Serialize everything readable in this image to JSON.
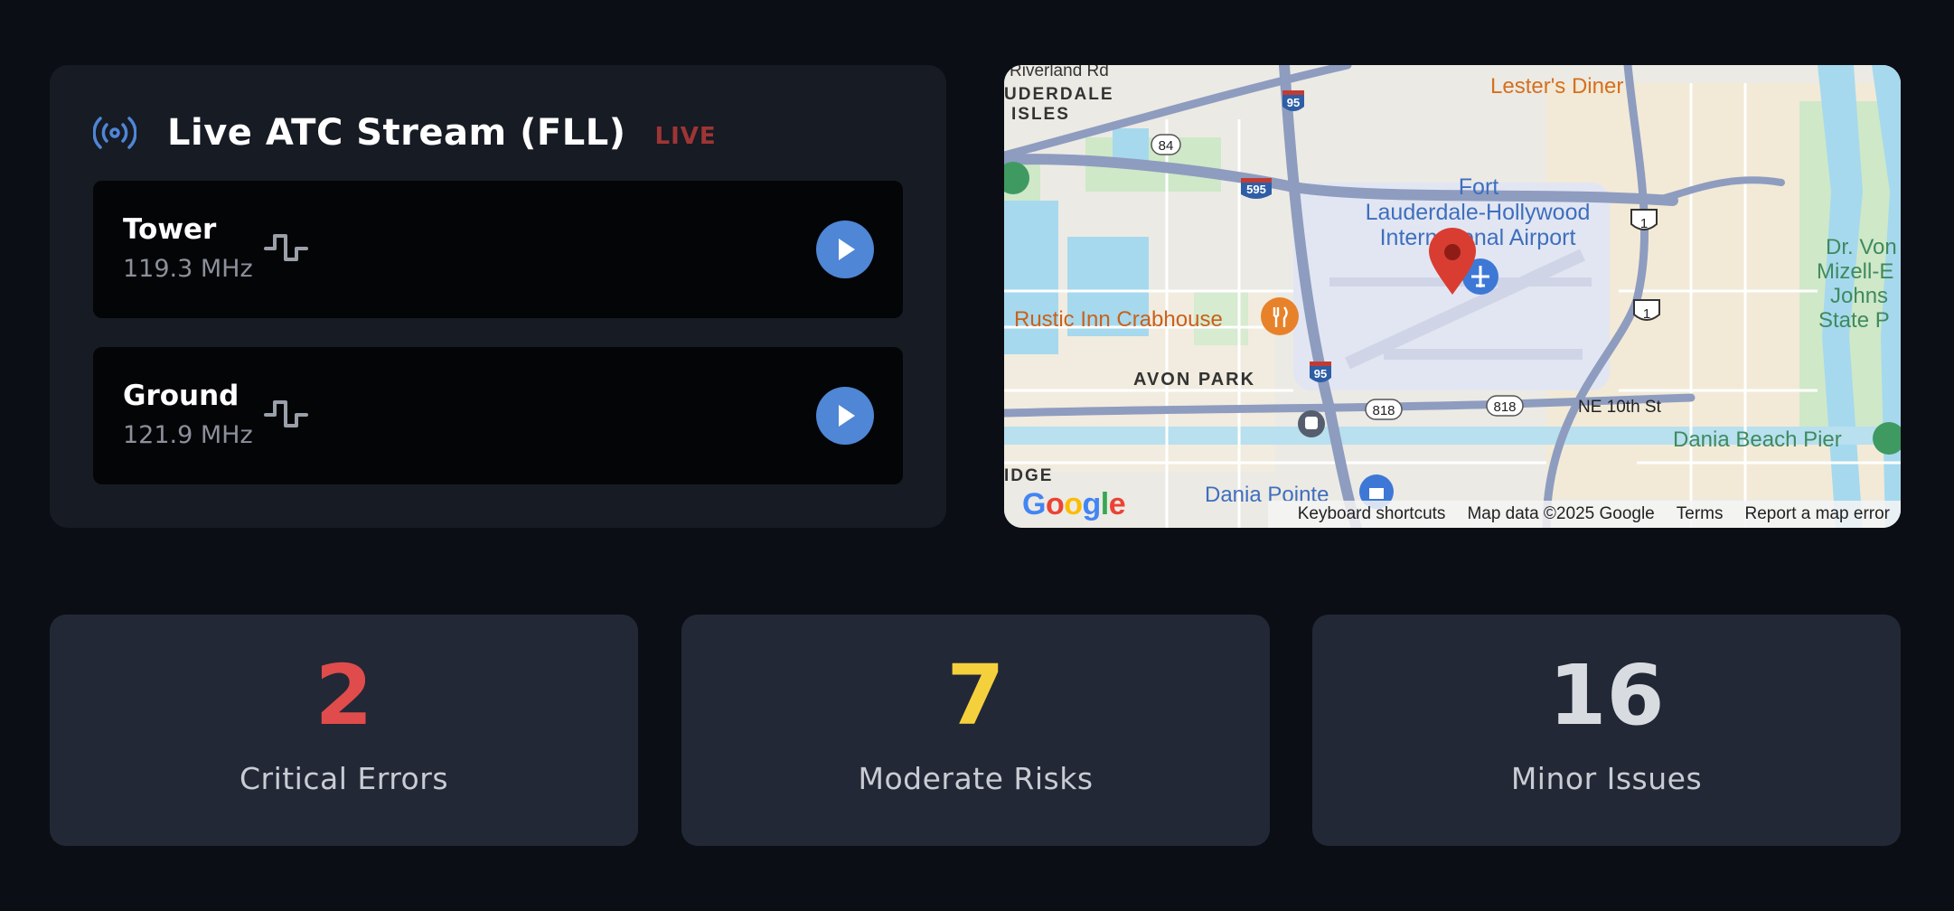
{
  "stream": {
    "title": "Live ATC Stream (FLL)",
    "live_label": "LIVE",
    "channels": [
      {
        "name": "Tower",
        "frequency": "119.3 MHz"
      },
      {
        "name": "Ground",
        "frequency": "121.9 MHz"
      }
    ]
  },
  "map": {
    "labels": {
      "riverland": "Riverland Rd",
      "lauderdale": "UDERDALE",
      "isles": "ISLES",
      "lesters": "Lester's Diner",
      "airport_1": "Fort",
      "airport_2": "Lauderdale-Hollywood",
      "airport_3": "International Airport",
      "rustic": "Rustic Inn Crabhouse",
      "avon": "AVON PARK",
      "ne10th": "NE 10th St",
      "dania_pier": "Dania Beach Pier",
      "dania_pointe": "Dania Pointe",
      "idge": "IDGE",
      "dr_von_1": "Dr. Von",
      "dr_von_2": "Mizell-E",
      "dr_von_3": "Johns",
      "dr_von_4": "State P",
      "shield_95a": "95",
      "shield_95b": "95",
      "shield_595": "595",
      "shield_84": "84",
      "shield_818a": "818",
      "shield_818b": "818",
      "shield_1a": "1",
      "shield_1b": "1"
    },
    "google_logo": "Google",
    "footer": {
      "shortcuts": "Keyboard shortcuts",
      "map_data": "Map data ©2025 Google",
      "terms": "Terms",
      "report": "Report a map error"
    }
  },
  "stats": [
    {
      "value": "2",
      "label": "Critical Errors",
      "color": "#e04b4b"
    },
    {
      "value": "7",
      "label": "Moderate Risks",
      "color": "#f5d03d"
    },
    {
      "value": "16",
      "label": "Minor Issues",
      "color": "#d8dbe0"
    }
  ],
  "colors": {
    "accent": "#4f86d6",
    "live": "#9e3535",
    "background": "#0b0e14"
  }
}
